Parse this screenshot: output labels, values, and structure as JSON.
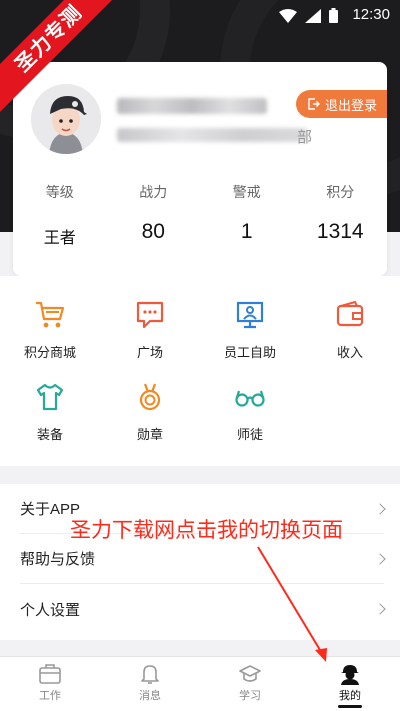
{
  "status_bar": {
    "time": "12:30"
  },
  "watermark": {
    "text": "圣力专测"
  },
  "profile": {
    "logout_label": "退出登录",
    "dept_tail": "部",
    "stats": [
      {
        "label": "等级",
        "value": "王者"
      },
      {
        "label": "战力",
        "value": "80"
      },
      {
        "label": "警戒",
        "value": "1"
      },
      {
        "label": "积分",
        "value": "1314"
      }
    ]
  },
  "grid": {
    "items": [
      {
        "label": "积分商城",
        "icon": "shopping-cart-icon"
      },
      {
        "label": "广场",
        "icon": "chat-bubble-icon"
      },
      {
        "label": "员工自助",
        "icon": "monitor-user-icon"
      },
      {
        "label": "收入",
        "icon": "wallet-icon"
      },
      {
        "label": "装备",
        "icon": "tshirt-icon"
      },
      {
        "label": "勋章",
        "icon": "medal-icon"
      },
      {
        "label": "师徒",
        "icon": "glasses-icon"
      }
    ]
  },
  "menu": {
    "items": [
      {
        "label": "关于APP"
      },
      {
        "label": "帮助与反馈"
      },
      {
        "label": "个人设置"
      }
    ]
  },
  "annotation": {
    "text": "圣力下载网点击我的切换页面"
  },
  "tabs": [
    {
      "label": "工作",
      "icon": "briefcase-icon"
    },
    {
      "label": "消息",
      "icon": "bell-icon"
    },
    {
      "label": "学习",
      "icon": "graduation-cap-icon"
    },
    {
      "label": "我的",
      "icon": "user-icon",
      "active": true
    }
  ],
  "colors": {
    "orange": "#f07a3c",
    "blue": "#2f7fd8",
    "teal": "#25a99a",
    "red": "#e3161f"
  }
}
